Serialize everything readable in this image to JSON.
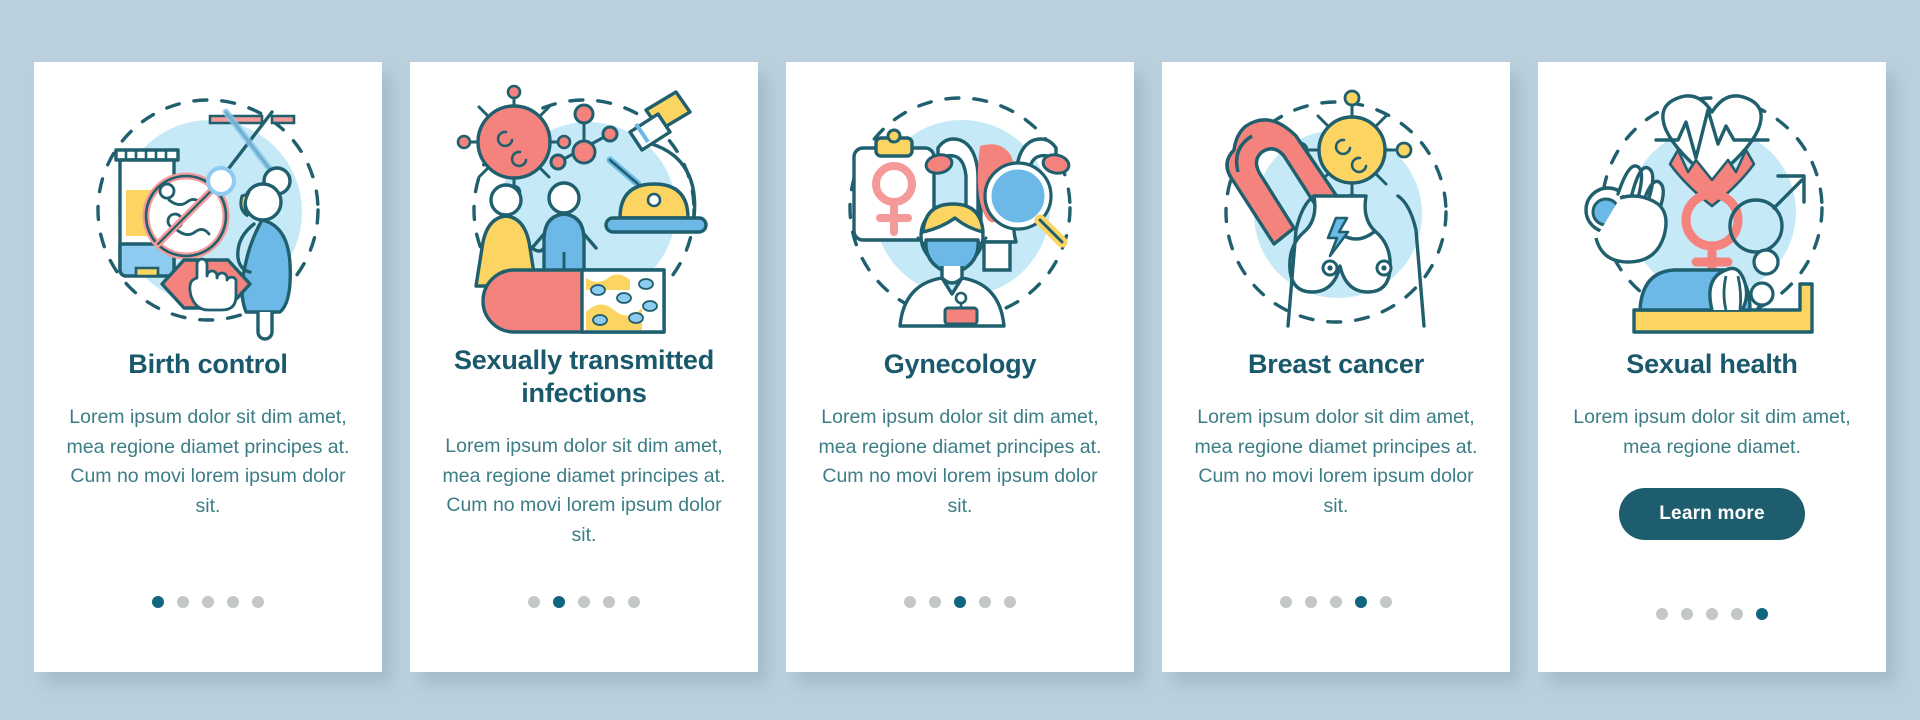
{
  "background_color": "#bad1dd",
  "theme": {
    "title_color": "#19596b",
    "body_color": "#3c7d86",
    "accent_color": "#10657f",
    "button_bg": "#1d5d6e",
    "button_text_color": "#ffffff",
    "dot_inactive_color": "#c4c7c8",
    "card_bg": "#ffffff",
    "illustration_blue_blob": "#c6e9f7",
    "illustration_outline": "#1f5f6e",
    "illustration_red": "#f4827d",
    "illustration_yellow": "#fcd462",
    "illustration_blue": "#6cb9e8",
    "illustration_pink": "#f49a98"
  },
  "screens": [
    {
      "id": "birth-control",
      "icon_name": "birth-control-icon",
      "title": "Birth control",
      "description": "Lorem ipsum dolor sit dim amet, mea regione diamet principes at. Cum no movi lorem ipsum dolor sit.",
      "has_button": false,
      "button_label": null,
      "dots": {
        "count": 5,
        "active_index": 0
      }
    },
    {
      "id": "sexually-transmitted-infections",
      "icon_name": "sti-icon",
      "title": "Sexually transmitted infections",
      "description": "Lorem ipsum dolor sit dim amet, mea regione diamet principes at. Cum no movi lorem ipsum dolor sit.",
      "has_button": false,
      "button_label": null,
      "dots": {
        "count": 5,
        "active_index": 1
      }
    },
    {
      "id": "gynecology",
      "icon_name": "gynecology-icon",
      "title": "Gynecology",
      "description": "Lorem ipsum dolor sit dim amet, mea regione diamet principes at. Cum no movi lorem ipsum dolor sit.",
      "has_button": false,
      "button_label": null,
      "dots": {
        "count": 5,
        "active_index": 2
      }
    },
    {
      "id": "breast-cancer",
      "icon_name": "breast-cancer-icon",
      "title": "Breast cancer",
      "description": "Lorem ipsum dolor sit dim amet, mea regione diamet principes at. Cum no movi lorem ipsum dolor sit.",
      "has_button": false,
      "button_label": null,
      "dots": {
        "count": 5,
        "active_index": 3
      }
    },
    {
      "id": "sexual-health",
      "icon_name": "sexual-health-icon",
      "title": "Sexual health",
      "description": "Lorem ipsum dolor sit dim amet, mea regione diamet.",
      "has_button": true,
      "button_label": "Learn more",
      "dots": {
        "count": 5,
        "active_index": 4
      }
    }
  ]
}
